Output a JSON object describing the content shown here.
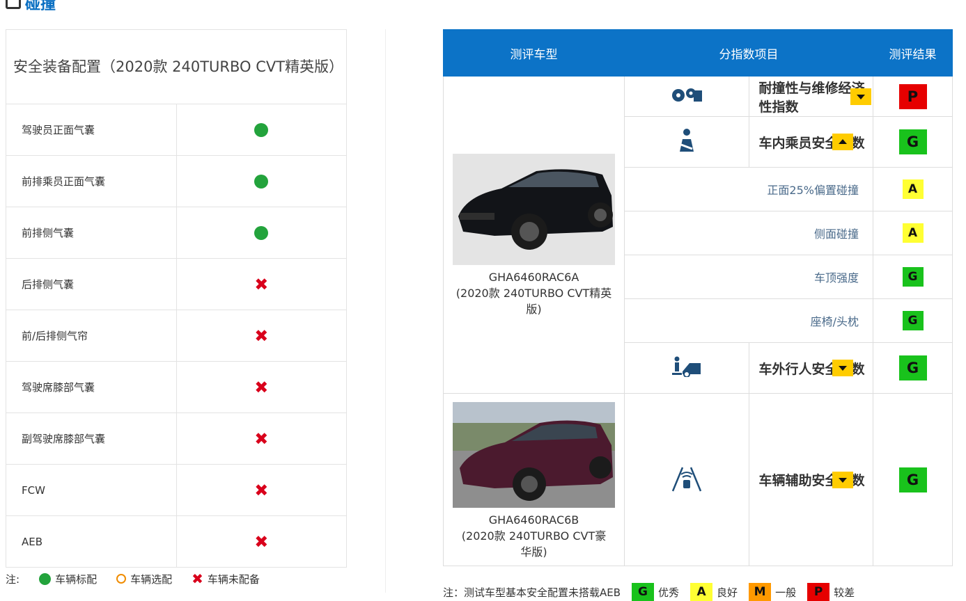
{
  "header": {
    "title": "碰撞"
  },
  "safety_table": {
    "title": "安全装备配置（2020款 240TURBO CVT精英版）",
    "rows": [
      {
        "label": "驾驶员正面气囊",
        "status": "standard"
      },
      {
        "label": "前排乘员正面气囊",
        "status": "standard"
      },
      {
        "label": "前排侧气囊",
        "status": "standard"
      },
      {
        "label": "后排侧气囊",
        "status": "none"
      },
      {
        "label": "前/后排侧气帘",
        "status": "none"
      },
      {
        "label": "驾驶席膝部气囊",
        "status": "none"
      },
      {
        "label": "副驾驶席膝部气囊",
        "status": "none"
      },
      {
        "label": "FCW",
        "status": "none"
      },
      {
        "label": "AEB",
        "status": "none"
      }
    ],
    "note": {
      "prefix": "注:",
      "standard": "车辆标配",
      "optional": "车辆选配",
      "none": "车辆未配备"
    }
  },
  "rating_table": {
    "headers": {
      "model": "测评车型",
      "index": "分指数项目",
      "result": "测评结果"
    },
    "car1": {
      "model": "GHA6460RAC6A",
      "trim": "(2020款 240TURBO CVT精英版)"
    },
    "car2": {
      "model": "GHA6460RAC6B",
      "trim": "(2020款 240TURBO CVT豪华版)"
    },
    "rows": {
      "durability": {
        "label": "耐撞性与维修经济性指数",
        "result": "P",
        "icon": "crash-gears-icon"
      },
      "occupant": {
        "label": "车内乘员安全指数",
        "result": "G",
        "icon": "seated-person-icon"
      },
      "frontal25": {
        "label": "正面25%偏置碰撞",
        "result": "A"
      },
      "side": {
        "label": "侧面碰撞",
        "result": "A"
      },
      "roof": {
        "label": "车顶强度",
        "result": "G"
      },
      "seat": {
        "label": "座椅/头枕",
        "result": "G"
      },
      "pedestrian": {
        "label": "车外行人安全指数",
        "result": "G",
        "icon": "pedestrian-car-icon"
      },
      "assist": {
        "label": "车辆辅助安全指数",
        "result": "G",
        "icon": "lane-assist-icon"
      }
    },
    "note": {
      "text": "注：测试车型基本安全配置未搭载AEB",
      "G": "优秀",
      "A": "良好",
      "M": "一般",
      "P": "较差"
    }
  },
  "colors": {
    "header_blue": "#0c73c7",
    "G": "#19c21c",
    "A": "#ffff33",
    "M": "#ff9900",
    "P": "#e60000"
  }
}
